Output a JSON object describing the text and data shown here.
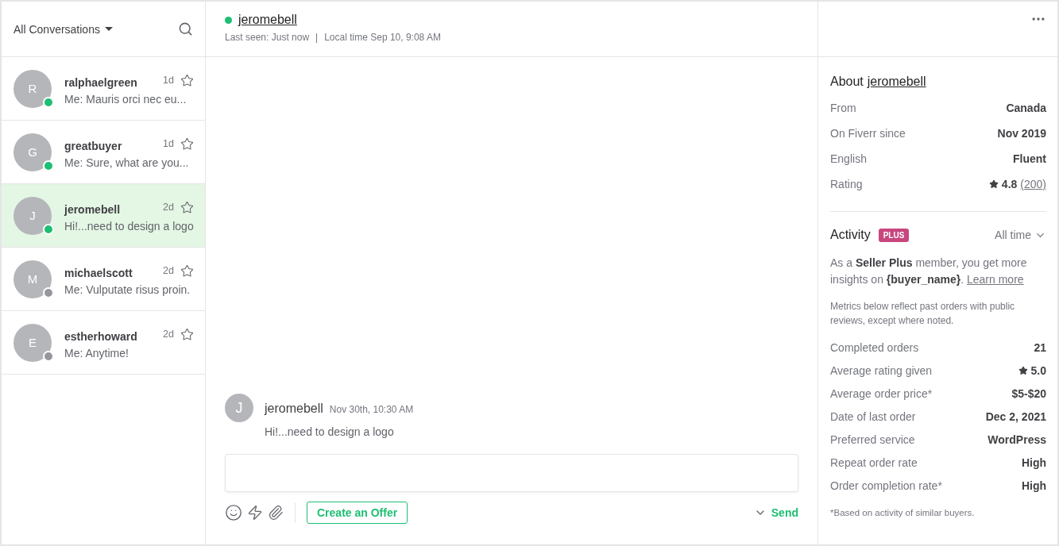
{
  "sidebar": {
    "filter": "All Conversations",
    "conversations": [
      {
        "initial": "R",
        "name": "ralphaelgreen",
        "time": "1d",
        "preview": "Me: Mauris orci nec eu...",
        "online": true,
        "selected": false,
        "starred": false
      },
      {
        "initial": "G",
        "name": "greatbuyer",
        "time": "1d",
        "preview": "Me: Sure, what are you...",
        "online": true,
        "selected": false,
        "starred": false
      },
      {
        "initial": "J",
        "name": "jeromebell",
        "time": "2d",
        "preview": "Hi!...need to design a logo",
        "online": true,
        "selected": true,
        "starred": false
      },
      {
        "initial": "M",
        "name": "michaelscott",
        "time": "2d",
        "preview": "Me: Vulputate risus proin.",
        "online": false,
        "selected": false,
        "starred": false
      },
      {
        "initial": "E",
        "name": "estherhoward",
        "time": "2d",
        "preview": "Me: Anytime!",
        "online": false,
        "selected": false,
        "starred": false
      }
    ]
  },
  "chat": {
    "header": {
      "name": "jeromebell",
      "online": true,
      "last_seen": "Last seen: Just now",
      "separator": "|",
      "local_time": "Local time Sep 10, 9:08 AM"
    },
    "messages": [
      {
        "initial": "J",
        "author": "jeromebell",
        "time": "Nov 30th, 10:30 AM",
        "text": "Hi!...need to design a logo"
      }
    ],
    "offer_button": "Create an Offer",
    "send_button": "Send"
  },
  "about": {
    "title": "About",
    "user": "jeromebell",
    "rows": [
      {
        "kind": "text",
        "label": "From",
        "value": "Canada"
      },
      {
        "kind": "text",
        "label": "On Fiverr since",
        "value": "Nov 2019"
      },
      {
        "kind": "text",
        "label": "English",
        "value": "Fluent"
      },
      {
        "kind": "rating",
        "label": "Rating",
        "value": "4.8",
        "count": "(200)"
      }
    ]
  },
  "activity": {
    "title": "Activity",
    "badge": "PLUS",
    "period": "All time",
    "intro": "As a **Seller Plus** member, you get more insights on **{buyer_name}**.",
    "link": "Learn more",
    "note": "Metrics below reflect past orders with public reviews, except where noted.",
    "metrics": [
      {
        "kind": "text",
        "label": "Completed orders",
        "value": "21"
      },
      {
        "kind": "rating",
        "label": "Average rating given",
        "value": "5.0"
      },
      {
        "kind": "text",
        "label": "Average order price*",
        "value": "$5-$20"
      },
      {
        "kind": "text",
        "label": "Date of last order",
        "value": "Dec 2, 2021"
      },
      {
        "kind": "text",
        "label": "Preferred service",
        "value": "WordPress"
      },
      {
        "kind": "text",
        "label": "Repeat order rate",
        "value": "High"
      },
      {
        "kind": "text",
        "label": "Order completion rate*",
        "value": "High"
      }
    ],
    "footnote": "*Based on activity of similar buyers."
  }
}
